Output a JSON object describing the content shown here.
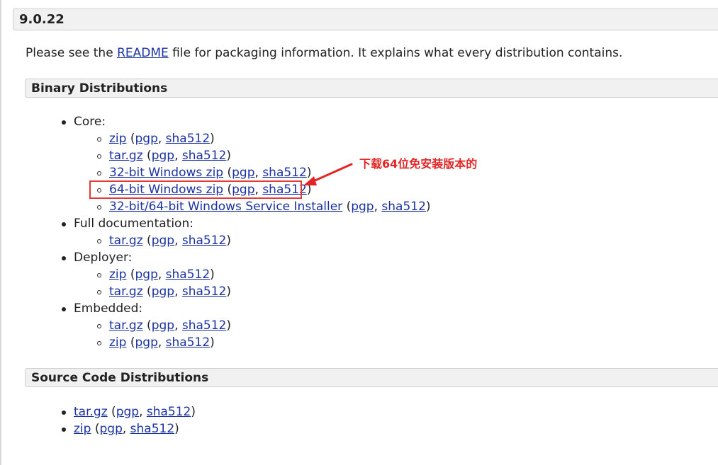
{
  "version": {
    "title": "9.0.22"
  },
  "intro": {
    "before": "Please see the ",
    "readme_link": "README",
    "after": " file for packaging information. It explains what every distribution contains."
  },
  "binary": {
    "title": "Binary Distributions",
    "core": {
      "label": "Core:",
      "items": [
        {
          "link": "zip",
          "pgp": "pgp",
          "sha": "sha512"
        },
        {
          "link": "tar.gz",
          "pgp": "pgp",
          "sha": "sha512"
        },
        {
          "link": "32-bit Windows zip",
          "pgp": "pgp",
          "sha": "sha512"
        },
        {
          "link": "64-bit Windows zip",
          "pgp": "pgp",
          "sha": "sha512"
        },
        {
          "link": "32-bit/64-bit Windows Service Installer",
          "pgp": "pgp",
          "sha": "sha512"
        }
      ]
    },
    "full_doc": {
      "label": "Full documentation:",
      "items": [
        {
          "link": "tar.gz",
          "pgp": "pgp",
          "sha": "sha512"
        }
      ]
    },
    "deployer": {
      "label": "Deployer:",
      "items": [
        {
          "link": "zip",
          "pgp": "pgp",
          "sha": "sha512"
        },
        {
          "link": "tar.gz",
          "pgp": "pgp",
          "sha": "sha512"
        }
      ]
    },
    "embedded": {
      "label": "Embedded:",
      "items": [
        {
          "link": "tar.gz",
          "pgp": "pgp",
          "sha": "sha512"
        },
        {
          "link": "zip",
          "pgp": "pgp",
          "sha": "sha512"
        }
      ]
    }
  },
  "source": {
    "title": "Source Code Distributions",
    "items": [
      {
        "link": "tar.gz",
        "pgp": "pgp",
        "sha": "sha512"
      },
      {
        "link": "zip",
        "pgp": "pgp",
        "sha": "sha512"
      }
    ]
  },
  "annotation": {
    "text": "下载64位免安装版本的",
    "color": "#e22525"
  },
  "colors": {
    "link": "#1b32a4",
    "header_bg": "#f1f1f1",
    "highlight": "#e43a3a"
  }
}
